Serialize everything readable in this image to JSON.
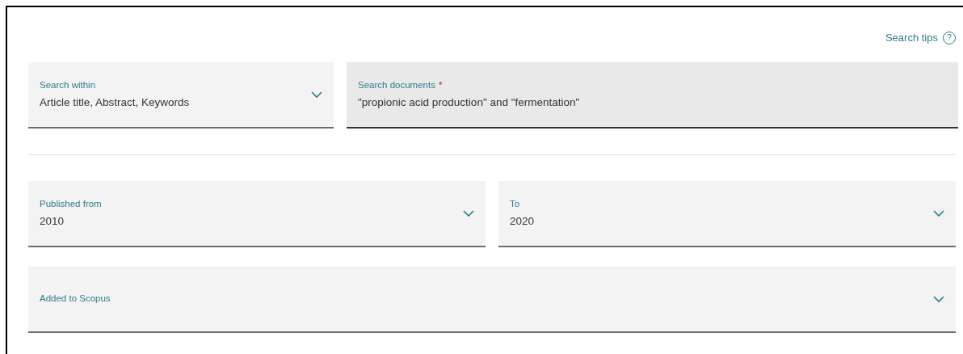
{
  "search_tips": {
    "label": "Search tips",
    "icon": "?"
  },
  "search_row": [
    {
      "kind": "select",
      "label": "Search within",
      "value": "Article title, Abstract, Keywords"
    },
    {
      "kind": "input",
      "label": "Search documents",
      "required_mark": "*",
      "value": "\"propionic acid production\" and \"fermentation\""
    }
  ],
  "date_range": [
    {
      "label": "Published from",
      "value": "2010"
    },
    {
      "label": "To",
      "value": "2020"
    }
  ],
  "added_to_scopus": {
    "label": "Added to Scopus"
  }
}
